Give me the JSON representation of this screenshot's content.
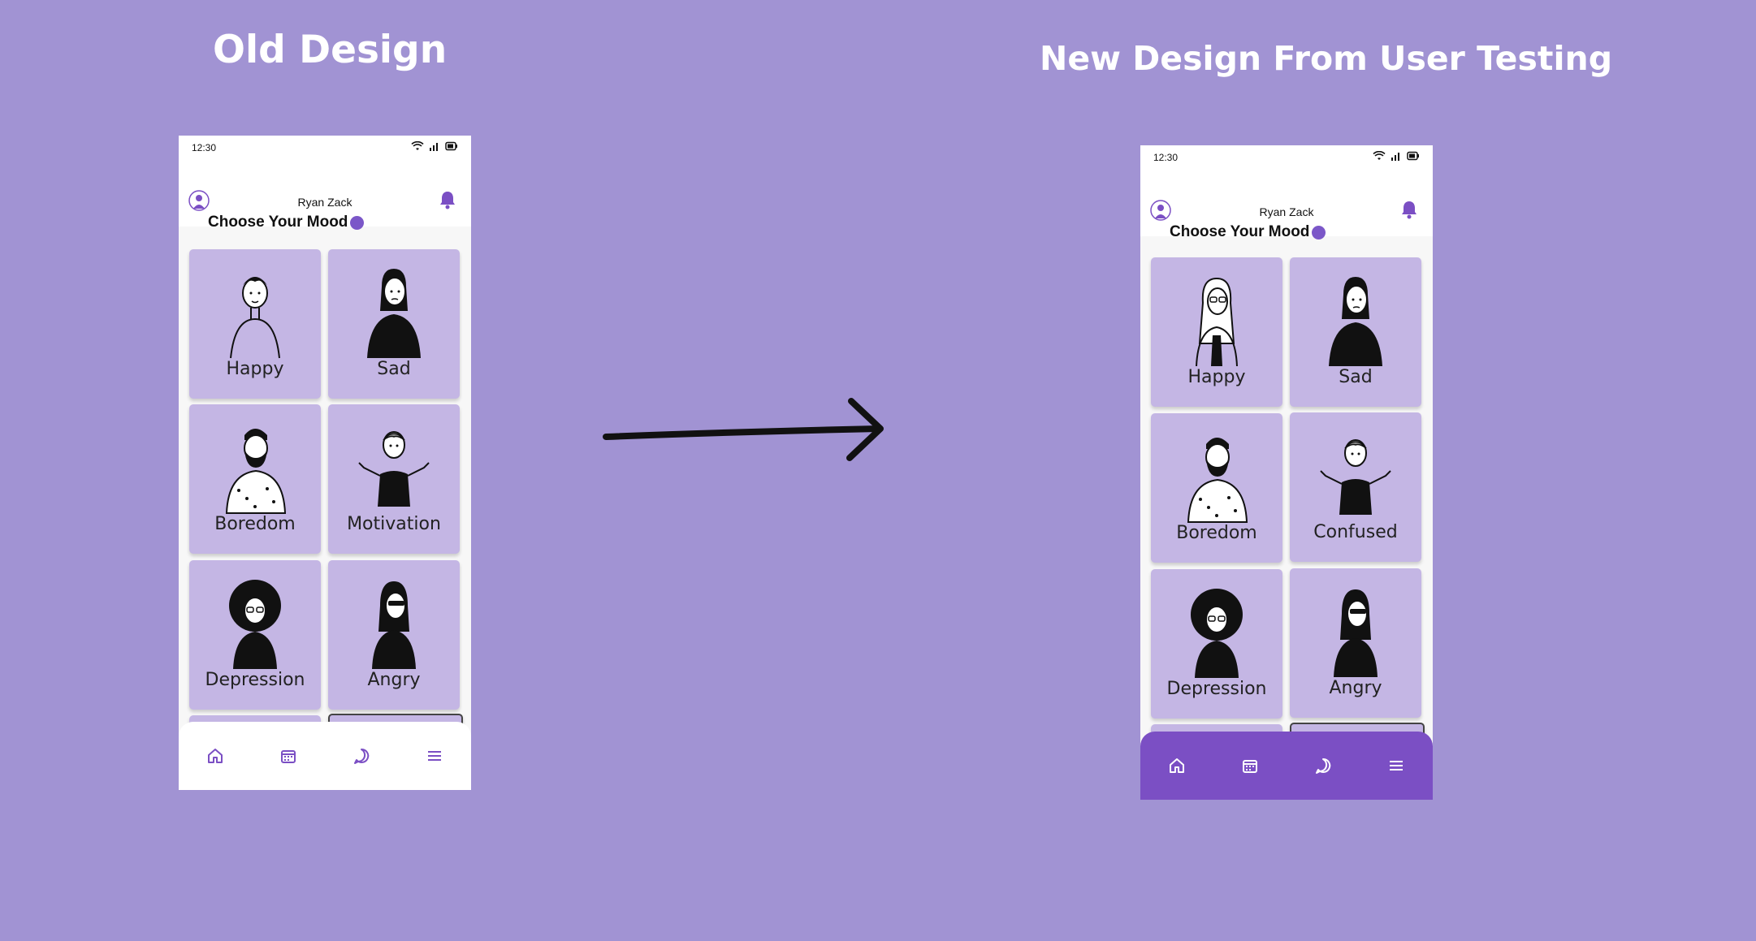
{
  "old_design": {
    "heading": "Old Design",
    "status_time": "12:30",
    "username": "Ryan Zack",
    "mood_title": "Choose Your Mood",
    "moods": [
      {
        "label": "Happy",
        "illustration": "boy-short-hair-icon"
      },
      {
        "label": "Sad",
        "illustration": "braided-woman-black-shirt-icon"
      },
      {
        "label": "Boredom",
        "illustration": "bearded-man-patterned-shirt-icon"
      },
      {
        "label": "Motivation",
        "illustration": "shrugging-man-icon"
      },
      {
        "label": "Depression",
        "illustration": "afro-woman-glasses-icon"
      },
      {
        "label": "Angry",
        "illustration": "woman-sunglasses-icon"
      }
    ],
    "nav": [
      "home-icon",
      "calendar-icon",
      "chat-icon",
      "menu-icon"
    ],
    "nav_color": "#7b4fc4",
    "nav_background": "#ffffff"
  },
  "new_design": {
    "heading": "New Design From User Testing",
    "status_time": "12:30",
    "username": "Ryan Zack",
    "mood_title": "Choose Your Mood",
    "moods": [
      {
        "label": "Happy",
        "illustration": "woman-glasses-long-hair-icon"
      },
      {
        "label": "Sad",
        "illustration": "braided-woman-black-shirt-icon"
      },
      {
        "label": "Boredom",
        "illustration": "bearded-man-patterned-shirt-icon"
      },
      {
        "label": "Confused",
        "illustration": "shrugging-man-icon"
      },
      {
        "label": "Depression",
        "illustration": "afro-woman-glasses-icon"
      },
      {
        "label": "Angry",
        "illustration": "woman-sunglasses-icon"
      }
    ],
    "nav": [
      "home-icon",
      "calendar-icon",
      "chat-icon",
      "menu-icon"
    ],
    "nav_color": "#ffffff",
    "nav_background": "#7b4fc4"
  },
  "colors": {
    "background": "#a193d3",
    "card": "#c4b6e4",
    "accent": "#7b4fc4"
  }
}
